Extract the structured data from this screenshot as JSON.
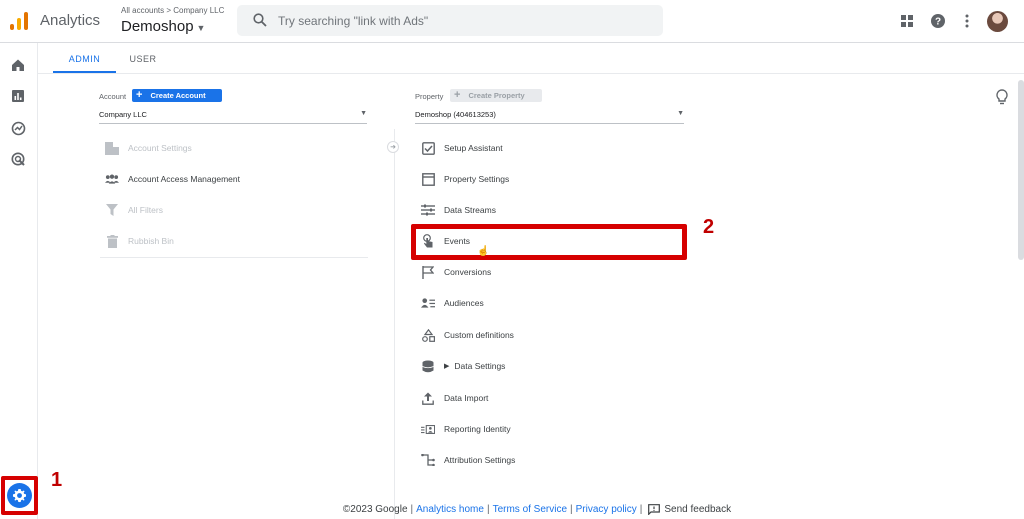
{
  "header": {
    "app_name": "Analytics",
    "breadcrumb": "All accounts > Company LLC",
    "property": "Demoshop",
    "search_placeholder": "Try searching \"link with Ads\""
  },
  "tabs": [
    {
      "label": "ADMIN",
      "active": true
    },
    {
      "label": "USER",
      "active": false
    }
  ],
  "account_column": {
    "label": "Account",
    "create_button": "Create Account",
    "selected": "Company LLC",
    "items": [
      {
        "label": "Account Settings",
        "icon": "building-icon",
        "enabled": false
      },
      {
        "label": "Account Access Management",
        "icon": "people-icon",
        "enabled": true
      },
      {
        "label": "All Filters",
        "icon": "filter-icon",
        "enabled": false
      },
      {
        "label": "Rubbish Bin",
        "icon": "trash-icon",
        "enabled": false
      }
    ]
  },
  "property_column": {
    "label": "Property",
    "create_button": "Create Property",
    "selected": "Demoshop (404613253)",
    "items": [
      {
        "label": "Setup Assistant",
        "icon": "checkbox-icon"
      },
      {
        "label": "Property Settings",
        "icon": "window-icon"
      },
      {
        "label": "Data Streams",
        "icon": "streams-icon"
      },
      {
        "label": "Events",
        "icon": "touch-icon"
      },
      {
        "label": "Conversions",
        "icon": "flag-icon"
      },
      {
        "label": "Audiences",
        "icon": "audience-icon"
      },
      {
        "label": "Custom definitions",
        "icon": "shapes-icon"
      },
      {
        "label": "Data Settings",
        "icon": "database-icon"
      },
      {
        "label": "Data Import",
        "icon": "upload-icon"
      },
      {
        "label": "Reporting Identity",
        "icon": "identity-icon"
      },
      {
        "label": "Attribution Settings",
        "icon": "attribution-icon"
      }
    ]
  },
  "annotations": {
    "step1": "1",
    "step2": "2"
  },
  "footer": {
    "copyright": "©2023 Google",
    "analytics_home": "Analytics home",
    "terms": "Terms of Service",
    "privacy": "Privacy policy",
    "feedback": "Send feedback"
  },
  "colors": {
    "accent": "#1a73e8",
    "annotation": "#d60000"
  }
}
